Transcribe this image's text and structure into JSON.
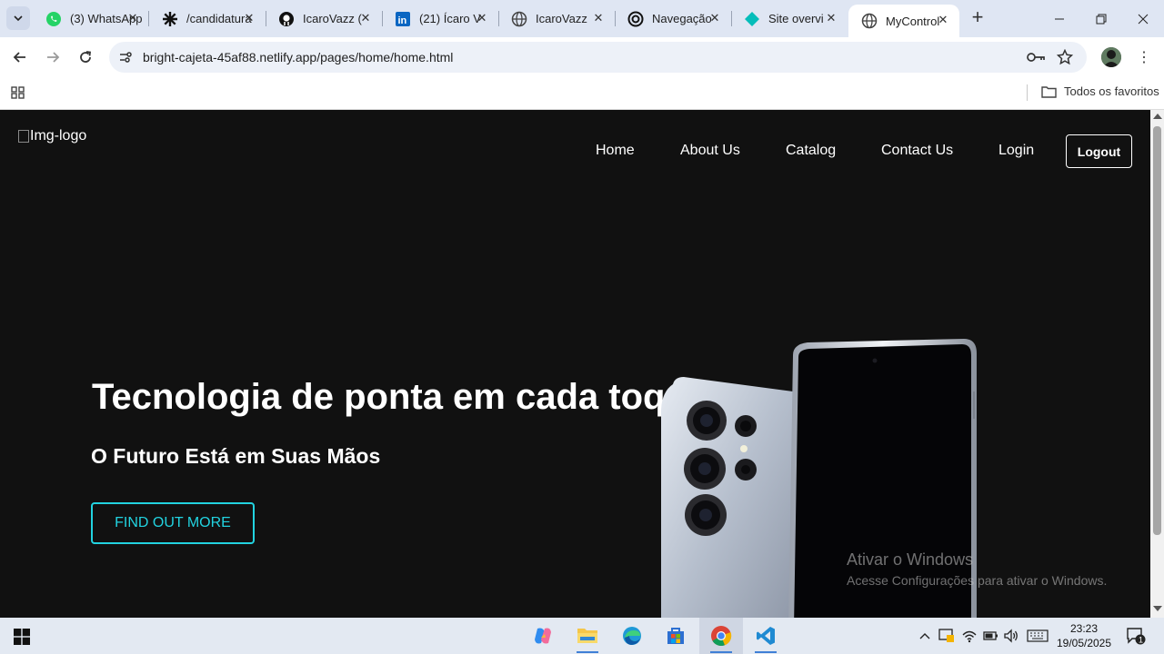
{
  "browser": {
    "tabs": [
      {
        "title": "(3) WhatsApp",
        "icon": "whatsapp-icon"
      },
      {
        "title": "/candidatura",
        "icon": "asterisk-icon"
      },
      {
        "title": "IcaroVazz (",
        "icon": "github-icon"
      },
      {
        "title": "(21) Ícaro V",
        "icon": "linkedin-icon"
      },
      {
        "title": "IcaroVazz",
        "icon": "globe-icon"
      },
      {
        "title": "Navegação",
        "icon": "openai-icon"
      },
      {
        "title": "Site overvi",
        "icon": "netlify-icon"
      },
      {
        "title": "MyControl",
        "icon": "globe-icon",
        "active": true
      }
    ],
    "url": "bright-cajeta-45af88.netlify.app/pages/home/home.html",
    "bookmarks_folder": "Todos os favoritos"
  },
  "page": {
    "logo_alt": "Img-logo",
    "nav": {
      "home": "Home",
      "about": "About Us",
      "catalog": "Catalog",
      "contact": "Contact Us",
      "login": "Login",
      "logout": "Logout"
    },
    "hero": {
      "title": "Tecnologia de ponta em cada toque",
      "subtitle": "O Futuro Está em Suas Mãos",
      "cta": "FIND OUT MORE"
    },
    "accent_color": "#22d3e0",
    "background_color": "#111111"
  },
  "watermark": {
    "line1": "Ativar o Windows",
    "line2": "Acesse Configurações para ativar o Windows."
  },
  "taskbar": {
    "time": "23:23",
    "date": "19/05/2025",
    "notification_count": "1"
  }
}
